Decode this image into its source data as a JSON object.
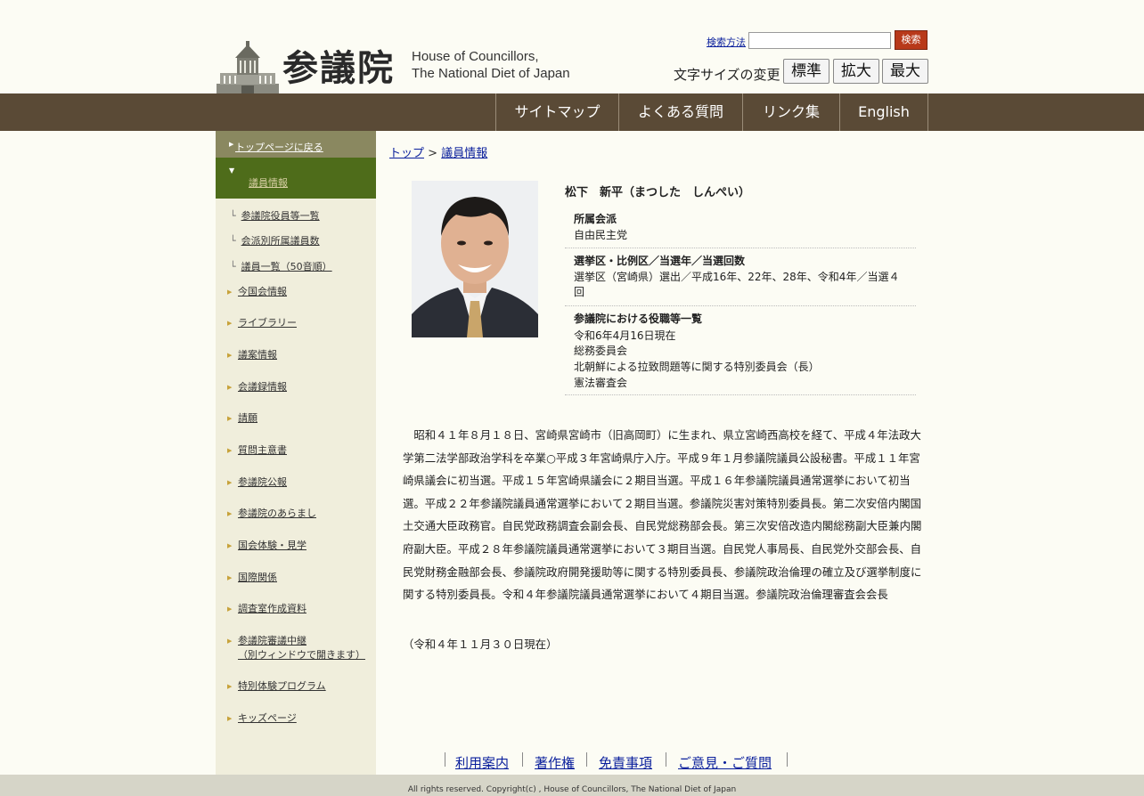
{
  "header": {
    "logo_kanji": "参議院",
    "logo_en_line1": "House of Councillors,",
    "logo_en_line2": "The National Diet of Japan",
    "search_how": "検索方法",
    "search_value": "",
    "search_button": "検索",
    "fontsize_label": "文字サイズの変更",
    "fontsize_buttons": [
      "標準",
      "拡大",
      "最大"
    ]
  },
  "global_nav": [
    "サイトマップ",
    "よくある質問",
    "リンク集",
    "English"
  ],
  "sidebar": {
    "top_link": "トップページに戻る",
    "current": "議員情報",
    "sub_items": [
      "参議院役員等一覧",
      "会派別所属議員数",
      "議員一覧（50音順）"
    ],
    "items": [
      "今国会情報",
      "ライブラリー",
      "議案情報",
      "会議録情報",
      "請願",
      "質問主意書",
      "参議院公報",
      "参議院のあらまし",
      "国会体験・見学",
      "国際関係",
      "調査室作成資料",
      "参議院審議中継",
      "（別ウィンドウで開きます）",
      "特別体験プログラム",
      "キッズページ"
    ]
  },
  "breadcrumb": {
    "home": "トップ",
    "sep": ">",
    "current": "議員情報"
  },
  "profile": {
    "name": "松下　新平（まつした　しんぺい）",
    "faction_title": "所属会派",
    "faction": "自由民主党",
    "district_title": "選挙区・比例区／当選年／当選回数",
    "district_line1": "選挙区（宮崎県）選出／平成16年、22年、28年、令和4年／当選４",
    "district_line2": "回",
    "roles_title": "参議院における役職等一覧",
    "roles": [
      "令和6年4月16日現在",
      "総務委員会",
      "北朝鮮による拉致問題等に関する特別委員会（長）",
      "憲法審査会"
    ]
  },
  "bio": "昭和４１年８月１８日、宮崎県宮崎市（旧高岡町）に生まれ、県立宮崎西高校を経て、平成４年法政大学第二法学部政治学科を卒業○平成３年宮崎県庁入庁。平成９年１月参議院議員公設秘書。平成１１年宮崎県議会に初当選。平成１５年宮崎県議会に２期目当選。平成１６年参議院議員通常選挙において初当選。平成２２年参議院議員通常選挙において２期目当選。参議院災害対策特別委員長。第二次安倍内閣国土交通大臣政務官。自民党政務調査会副会長、自民党総務部会長。第三次安倍改造内閣総務副大臣兼内閣府副大臣。平成２８年参議院議員通常選挙において３期目当選。自民党人事局長、自民党外交部会長、自民党財務金融部会長、参議院政府開発援助等に関する特別委員長、参議院政治倫理の確立及び選挙制度に関する特別委員長。令和４年参議院議員通常選挙において４期目当選。参議院政治倫理審査会会長",
  "bio_date": "（令和４年１１月３０日現在）",
  "footer_links": [
    "利用案内",
    "著作権",
    "免責事項",
    "ご意見・ご質問"
  ],
  "copyright": "All rights reserved. Copyright(c) , House of Councillors, The National Diet of Japan",
  "colors": {
    "nav_bg": "#5a4a36",
    "side_current": "#4e6c1a",
    "search_btn": "#b8391a"
  }
}
